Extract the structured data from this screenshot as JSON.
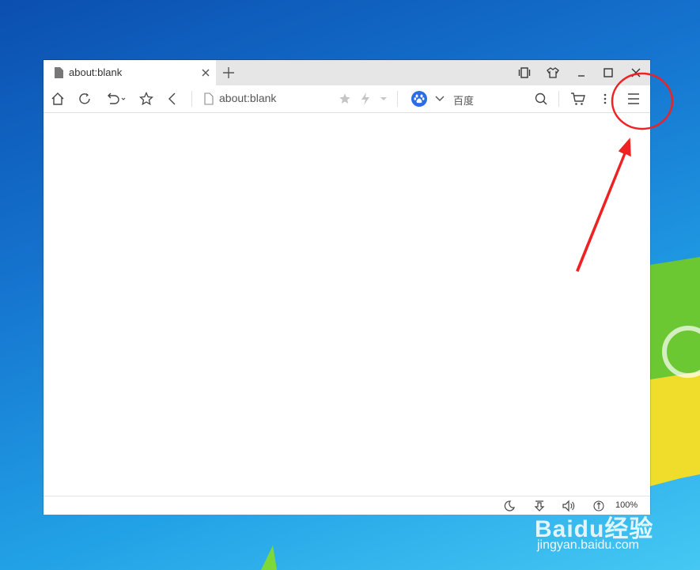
{
  "tab": {
    "title": "about:blank"
  },
  "address_bar": {
    "url": "about:blank"
  },
  "search_bar": {
    "engine_label": "百度"
  },
  "statusbar": {
    "zoom": "100%"
  },
  "watermark": {
    "logo_text": "Baidu经验",
    "url_text": "jingyan.baidu.com"
  },
  "annotation": {
    "color": "#ee2222",
    "target": "menu-button"
  },
  "colors": {
    "accent": "#2b6de5",
    "tabbar": "#e6e6e6"
  },
  "icons": [
    "home-icon",
    "reload-icon",
    "undo-icon",
    "favorite-icon",
    "back-icon",
    "page-icon",
    "star-icon",
    "lightning-icon",
    "baidu-paw-icon",
    "search-icon",
    "cart-icon",
    "more-icon",
    "menu-icon",
    "night-mode-icon",
    "download-icon",
    "volume-icon",
    "zoom-icon"
  ]
}
